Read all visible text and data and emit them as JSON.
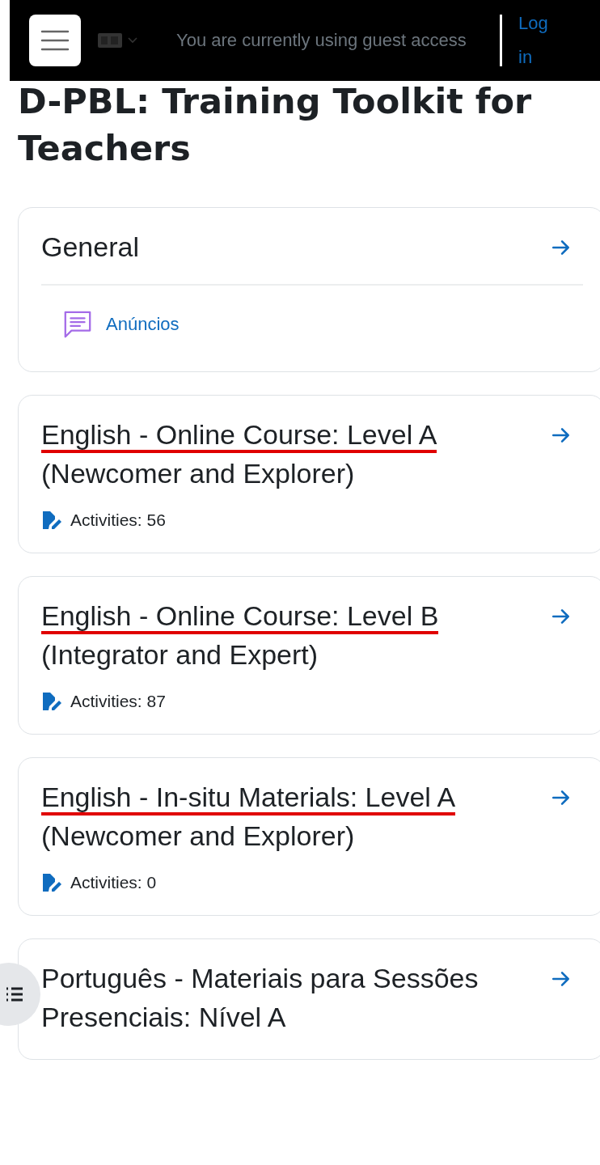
{
  "header": {
    "language_menu": {
      "expanded": false
    },
    "notice": "You are currently using guest access",
    "login": "Log in"
  },
  "course_title": "D-PBL: Training Toolkit for Teachers",
  "sections": [
    {
      "kind": "general",
      "title_parts": [
        {
          "text": "General",
          "underlined": false
        }
      ],
      "activities": [
        {
          "label": "Anúncios"
        }
      ]
    },
    {
      "kind": "summary",
      "title_parts": [
        {
          "text": "English - Online Course: Level A ",
          "underlined": true
        },
        {
          "text": "(Newcomer and Explorer)",
          "underlined": false
        }
      ],
      "count": "Activities: 56"
    },
    {
      "kind": "summary",
      "title_parts": [
        {
          "text": "English - Online Course: Level B",
          "underlined": true
        },
        {
          "text": " (Integrator and Expert)",
          "underlined": false
        }
      ],
      "count": "Activities: 87"
    },
    {
      "kind": "summary",
      "title_parts": [
        {
          "text": "English - In-situ Materials: Level A ",
          "underlined": true
        },
        {
          "text": "(Newcomer and Explorer)",
          "underlined": false
        }
      ],
      "count": "Activities: 0"
    },
    {
      "kind": "summary",
      "title_parts": [
        {
          "text": "Português - Materiais para Sessões Presenciais: Nível A",
          "underlined": false
        }
      ]
    }
  ]
}
